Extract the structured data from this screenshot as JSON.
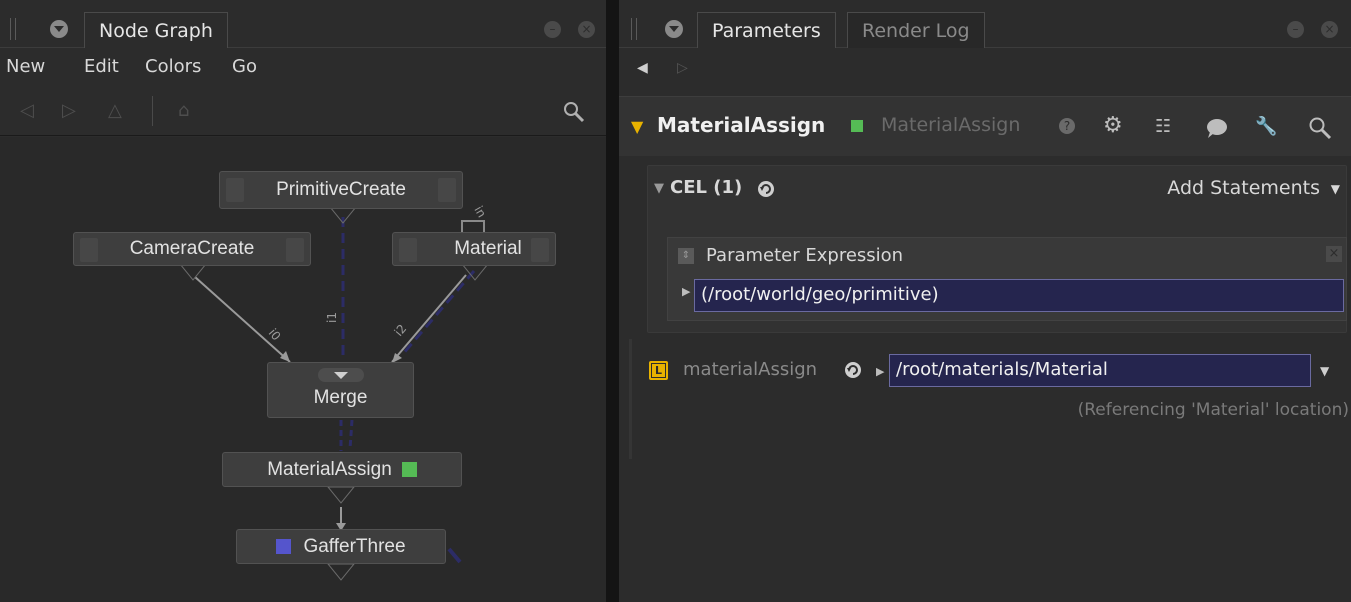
{
  "left_pane": {
    "tab": "Node Graph",
    "menu": [
      "New",
      "Edit",
      "Colors",
      "Go"
    ],
    "nodes": {
      "primitive_create": "PrimitiveCreate",
      "camera_create": "CameraCreate",
      "material": "Material",
      "merge": "Merge",
      "material_assign": "MaterialAssign",
      "gaffer_three": "GafferThree"
    },
    "edge_labels": {
      "camera_to_merge": "i0",
      "primitive_to_merge": "i1",
      "material_to_merge": "i2",
      "material_input": "in"
    },
    "colors": {
      "material_assign_swatch": "#55bb55",
      "gaffer_three_swatch": "#5555cc"
    }
  },
  "right_pane": {
    "tabs": [
      "Parameters",
      "Render Log"
    ],
    "node_name": "MaterialAssign",
    "node_type": "MaterialAssign",
    "cel": {
      "title": "CEL (1)",
      "add_statements": "Add Statements",
      "expression_title": "Parameter Expression",
      "expression_value": "(/root/world/geo/primitive)"
    },
    "material_assign": {
      "badge": "L",
      "label": "materialAssign",
      "value": "/root/materials/Material",
      "note": "(Referencing 'Material' location)"
    },
    "colors": {
      "accent": "#e8b200",
      "status": "#55bb55"
    }
  }
}
